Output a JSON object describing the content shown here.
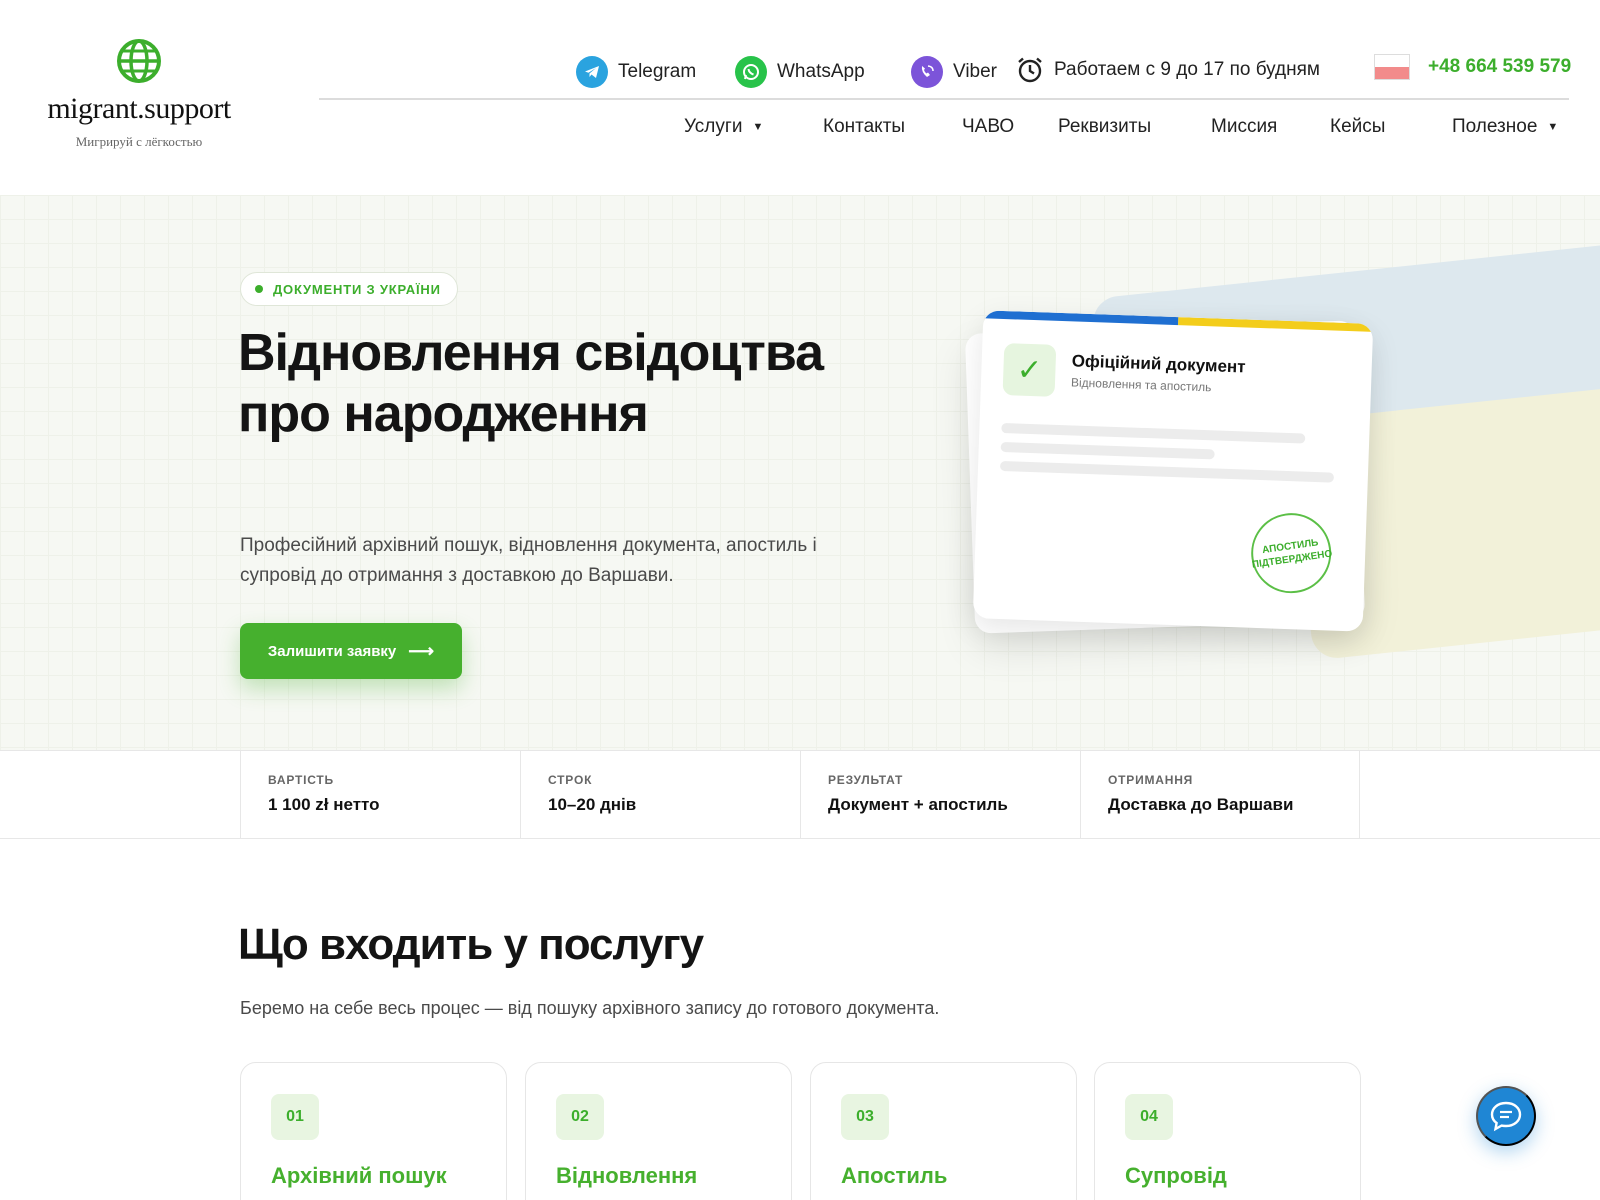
{
  "brand": {
    "name": "migrant.support",
    "tagline": "Мигрируй с лёгкостью",
    "accent": "#46b02e"
  },
  "contacts": {
    "telegram": "Telegram",
    "whatsapp": "WhatsApp",
    "viber": "Viber",
    "hours": "Работаем с 9 до 17 по будням",
    "phone": "+48 664 539 579"
  },
  "nav": {
    "items": [
      {
        "label": "Услуги"
      },
      {
        "label": "Контакты"
      },
      {
        "label": "ЧАВО"
      },
      {
        "label": "Реквизиты"
      },
      {
        "label": "Миссия"
      },
      {
        "label": "Кейсы"
      },
      {
        "label": "Полезное"
      }
    ]
  },
  "hero": {
    "badge": "ДОКУМЕНТИ З УКРАЇНИ",
    "title": "Відновлення свідоцтва про народження",
    "description": "Професійний архівний пошук, відновлення документа, апостиль і супровід до отримання з доставкою до Варшави.",
    "cta": "Залишити заявку",
    "doc_card": {
      "title": "Офіційний документ",
      "subtitle": "Відновлення та апостиль",
      "stamp_line1": "АПОСТИЛЬ",
      "stamp_line2": "ПІДТВЕРДЖЕНО"
    }
  },
  "stats": [
    {
      "label": "ВАРТІСТЬ",
      "value": "1 100 zł нетто"
    },
    {
      "label": "СТРОК",
      "value": "10–20 днів"
    },
    {
      "label": "РЕЗУЛЬТАТ",
      "value": "Документ + апостиль"
    },
    {
      "label": "ОТРИМАННЯ",
      "value": "Доставка до Варшави"
    }
  ],
  "services": {
    "title": "Що входить у послугу",
    "description": "Беремо на себе весь процес — від пошуку архівного запису до готового документа.",
    "cards": [
      {
        "num": "01",
        "title": "Архівний пошук"
      },
      {
        "num": "02",
        "title": "Відновлення"
      },
      {
        "num": "03",
        "title": "Апостиль"
      },
      {
        "num": "04",
        "title": "Супровід"
      }
    ]
  }
}
